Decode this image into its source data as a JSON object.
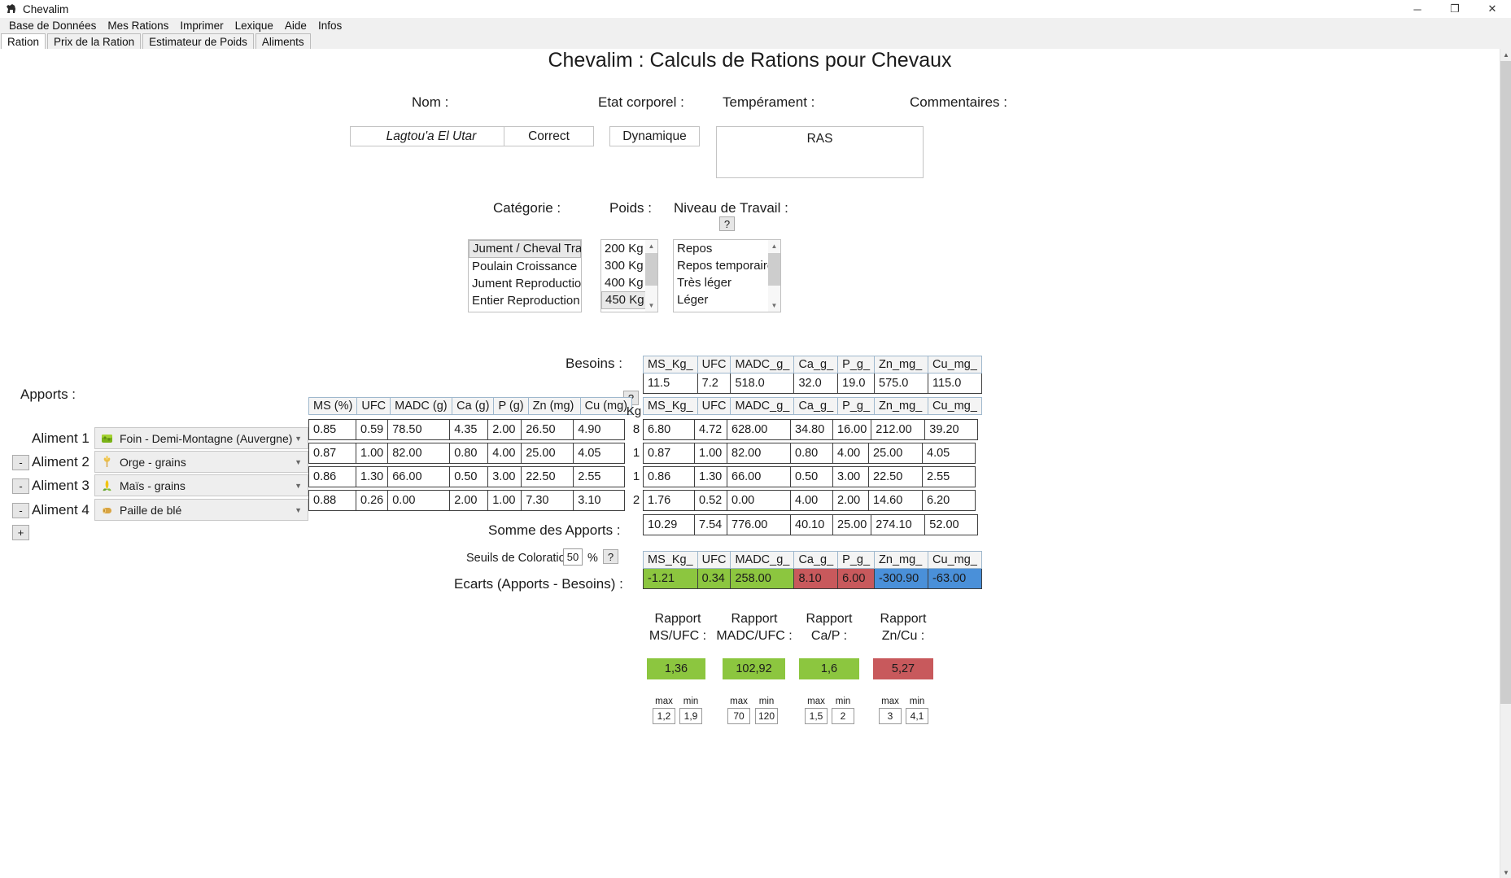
{
  "window": {
    "title": "Chevalim",
    "icon": "horse-icon",
    "buttons": {
      "minimize": "─",
      "maximize": "❐",
      "close": "✕"
    }
  },
  "menubar": [
    "Base de Données",
    "Mes Rations",
    "Imprimer",
    "Lexique",
    "Aide",
    "Infos"
  ],
  "tabs": [
    {
      "label": "Ration",
      "active": true
    },
    {
      "label": "Prix de la Ration",
      "active": false
    },
    {
      "label": "Estimateur de Poids",
      "active": false
    },
    {
      "label": "Aliments",
      "active": false
    }
  ],
  "page_title": "Chevalim : Calculs de Rations pour Chevaux",
  "identity": {
    "nom_label": "Nom :",
    "nom_value": "Lagtou'a El Utar",
    "etat_label": "Etat corporel :",
    "etat_value": "Correct",
    "temperament_label": "Tempérament :",
    "temperament_value": "Dynamique",
    "commentaires_label": "Commentaires :",
    "commentaires_value": "RAS"
  },
  "selectors": {
    "categorie_label": "Catégorie :",
    "categorie_options": [
      "Jument / Cheval Travail",
      "Poulain Croissance",
      "Jument Reproduction",
      "Entier Reproduction"
    ],
    "categorie_selected": "Jument / Cheval Travail",
    "poids_label": "Poids :",
    "poids_options": [
      "200 Kg",
      "300 Kg",
      "400 Kg",
      "450 Kg"
    ],
    "poids_selected": "450 Kg",
    "travail_label": "Niveau de Travail :",
    "travail_help": "?",
    "travail_options": [
      "Repos",
      "Repos temporaire",
      "Très léger",
      "Léger"
    ],
    "travail_selected": "Léger"
  },
  "besoins": {
    "label": "Besoins :",
    "help": "?",
    "headers": [
      "MS_Kg_",
      "UFC",
      "MADC_g_",
      "Ca_g_",
      "P_g_",
      "Zn_mg_",
      "Cu_mg_"
    ],
    "values": [
      "11.5",
      "7.2",
      "518.0",
      "32.0",
      "19.0",
      "575.0",
      "115.0"
    ]
  },
  "apports": {
    "label": "Apports :",
    "add_button": "+",
    "remove_button": "-",
    "kg_header": "Kg",
    "unit_headers": [
      "MS (%)",
      "UFC",
      "MADC (g)",
      "Ca (g)",
      "P (g)",
      "Zn (mg)",
      "Cu (mg)"
    ],
    "total_headers": [
      "MS_Kg_",
      "UFC",
      "MADC_g_",
      "Ca_g_",
      "P_g_",
      "Zn_mg_",
      "Cu_mg_"
    ],
    "rows": [
      {
        "label": "Aliment 1 :",
        "icon": "hay-bale-icon",
        "food": "Foin - Demi-Montagne (Auvergne)",
        "unit": [
          "0.85",
          "0.59",
          "78.50",
          "4.35",
          "2.00",
          "26.50",
          "4.90"
        ],
        "kg": "8",
        "total": [
          "6.80",
          "4.72",
          "628.00",
          "34.80",
          "16.00",
          "212.00",
          "39.20"
        ],
        "removable": false
      },
      {
        "label": "Aliment 2 :",
        "icon": "wheat-icon",
        "food": "Orge - grains",
        "unit": [
          "0.87",
          "1.00",
          "82.00",
          "0.80",
          "4.00",
          "25.00",
          "4.05"
        ],
        "kg": "1",
        "total": [
          "0.87",
          "1.00",
          "82.00",
          "0.80",
          "4.00",
          "25.00",
          "4.05"
        ],
        "removable": true
      },
      {
        "label": "Aliment 3 :",
        "icon": "corn-icon",
        "food": "Maïs - grains",
        "unit": [
          "0.86",
          "1.30",
          "66.00",
          "0.50",
          "3.00",
          "22.50",
          "2.55"
        ],
        "kg": "1",
        "total": [
          "0.86",
          "1.30",
          "66.00",
          "0.50",
          "3.00",
          "22.50",
          "2.55"
        ],
        "removable": true
      },
      {
        "label": "Aliment 4 :",
        "icon": "straw-icon",
        "food": "Paille de blé",
        "unit": [
          "0.88",
          "0.26",
          "0.00",
          "2.00",
          "1.00",
          "7.30",
          "3.10"
        ],
        "kg": "2",
        "total": [
          "1.76",
          "0.52",
          "0.00",
          "4.00",
          "2.00",
          "14.60",
          "6.20"
        ],
        "removable": true
      }
    ],
    "somme_label": "Somme des Apports :",
    "somme": [
      "10.29",
      "7.54",
      "776.00",
      "40.10",
      "25.00",
      "274.10",
      "52.00"
    ]
  },
  "seuils": {
    "label": "Seuils de Coloration :",
    "value": "50",
    "percent": "%",
    "help": "?"
  },
  "ecarts": {
    "label": "Ecarts (Apports - Besoins) :",
    "headers": [
      "MS_Kg_",
      "UFC",
      "MADC_g_",
      "Ca_g_",
      "P_g_",
      "Zn_mg_",
      "Cu_mg_"
    ],
    "cells": [
      {
        "value": "-1.21",
        "color": "green"
      },
      {
        "value": "0.34",
        "color": "green"
      },
      {
        "value": "258.00",
        "color": "green"
      },
      {
        "value": "8.10",
        "color": "red"
      },
      {
        "value": "6.00",
        "color": "red"
      },
      {
        "value": "-300.90",
        "color": "blue"
      },
      {
        "value": "-63.00",
        "color": "blue"
      }
    ]
  },
  "ratios": [
    {
      "title_line1": "Rapport",
      "title_line2": "MS/UFC :",
      "value": "1,36",
      "color": "green",
      "max_label": "max",
      "min_label": "min",
      "max": "1,2",
      "min": "1,9"
    },
    {
      "title_line1": "Rapport",
      "title_line2": "MADC/UFC :",
      "value": "102,92",
      "color": "green",
      "max_label": "max",
      "min_label": "min",
      "max": "70",
      "min": "120"
    },
    {
      "title_line1": "Rapport",
      "title_line2": "Ca/P :",
      "value": "1,6",
      "color": "green",
      "max_label": "max",
      "min_label": "min",
      "max": "1,5",
      "min": "2"
    },
    {
      "title_line1": "Rapport",
      "title_line2": "Zn/Cu :",
      "value": "5,27",
      "color": "red",
      "max_label": "max",
      "min_label": "min",
      "max": "3",
      "min": "4,1"
    }
  ],
  "colors": {
    "green": "#8cc63f",
    "red": "#c8595c",
    "blue": "#4a90d9",
    "grid_border": "#6e93b8"
  }
}
